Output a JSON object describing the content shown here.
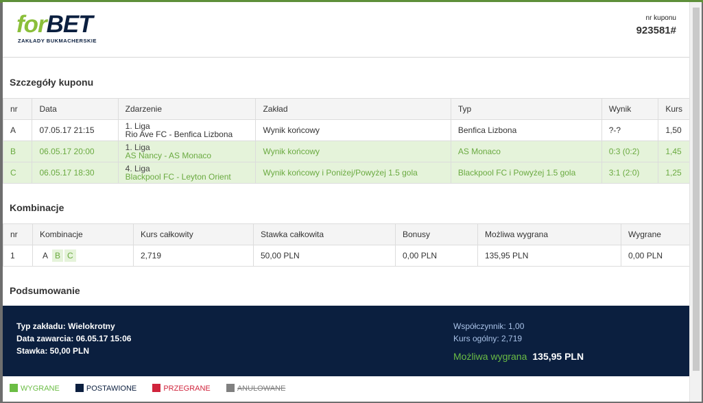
{
  "header": {
    "logo": {
      "part1": "for",
      "part2": "BET",
      "tagline": "ZAKŁADY BUKMACHERSKIE"
    },
    "coupon_label": "nr kuponu",
    "coupon_number": "923581#"
  },
  "details": {
    "title": "Szczegóły kuponu",
    "columns": [
      "nr",
      "Data",
      "Zdarzenie",
      "Zakład",
      "Typ",
      "Wynik",
      "Kurs"
    ],
    "rows": [
      {
        "nr": "A",
        "date": "07.05.17 21:15",
        "league": "1. Liga",
        "match": "Rio Ave FC - Benfica Lizbona",
        "bet": "Wynik końcowy",
        "type": "Benfica Lizbona",
        "result": "?-?",
        "odds": "1,50",
        "status": "pending"
      },
      {
        "nr": "B",
        "date": "06.05.17 20:00",
        "league": "1. Liga",
        "match": "AS Nancy - AS Monaco",
        "bet": "Wynik końcowy",
        "type": "AS Monaco",
        "result": "0:3 (0:2)",
        "odds": "1,45",
        "status": "won"
      },
      {
        "nr": "C",
        "date": "06.05.17 18:30",
        "league": "4. Liga",
        "match": "Blackpool FC - Leyton Orient",
        "bet": "Wynik końcowy i Poniżej/Powyżej 1.5 gola",
        "type": "Blackpool FC i Powyżej 1.5 gola",
        "result": "3:1 (2:0)",
        "odds": "1,25",
        "status": "won"
      }
    ]
  },
  "combinations": {
    "title": "Kombinacje",
    "columns": [
      "nr",
      "Kombinacje",
      "Kurs całkowity",
      "Stawka całkowita",
      "Bonusy",
      "Możliwa wygrana",
      "Wygrane"
    ],
    "row": {
      "nr": "1",
      "combo": [
        "A",
        "B",
        "C"
      ],
      "total_odds": "2,719",
      "total_stake": "50,00 PLN",
      "bonus": "0,00 PLN",
      "possible_win": "135,95 PLN",
      "won": "0,00 PLN"
    }
  },
  "summary": {
    "title": "Podsumowanie",
    "bet_type": "Typ zakładu: Wielokrotny",
    "date": "Data zawarcia: 06.05.17 15:06",
    "stake": "Stawka: 50,00 PLN",
    "coefficient": "Współczynnik: 1,00",
    "total_odds": "Kurs ogólny: 2,719",
    "possible_win_label": "Możliwa wygrana",
    "possible_win_value": "135,95 PLN"
  },
  "legend": [
    {
      "label": "WYGRANE",
      "color": "#6bbd45"
    },
    {
      "label": "POSTAWIONE",
      "color": "#0b1f3f"
    },
    {
      "label": "PRZEGRANE",
      "color": "#d0243c"
    },
    {
      "label": "ANULOWANE",
      "color": "#808080"
    }
  ]
}
